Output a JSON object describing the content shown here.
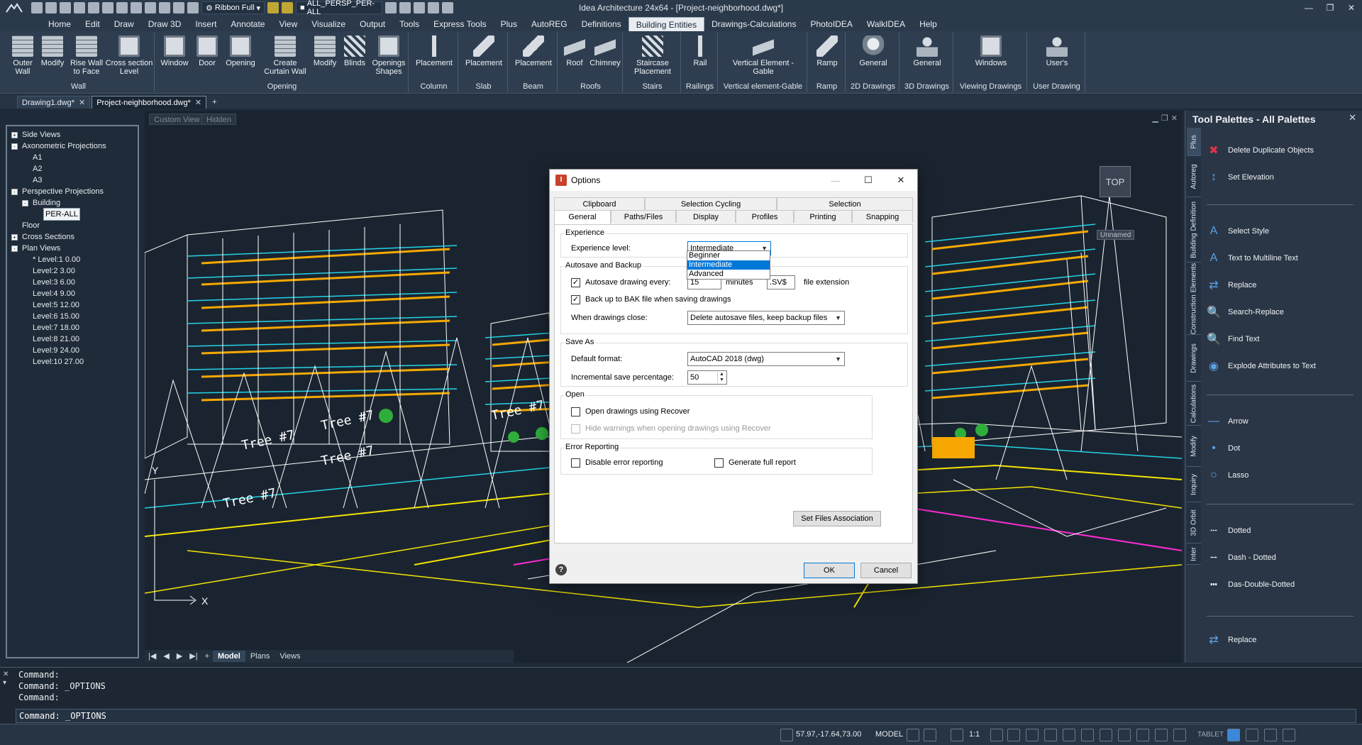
{
  "window": {
    "title": "Idea Architecture 24x64 - [Project-neighborhood.dwg*]",
    "workspace_label": "Ribbon Full",
    "view_selector": "ALL_PERSP_PER-ALL"
  },
  "ribbon_tabs": [
    "Home",
    "Edit",
    "Draw",
    "Draw 3D",
    "Insert",
    "Annotate",
    "View",
    "Visualize",
    "Output",
    "Tools",
    "Express Tools",
    "Plus",
    "AutoREG",
    "Definitions",
    "Building Entities",
    "Drawings-Calculations",
    "PhotoIDEA",
    "WalkIDEA",
    "Help"
  ],
  "ribbon_active_tab": "Building Entities",
  "ribbon_groups": {
    "wall": {
      "label": "Wall",
      "buttons": [
        "Outer Wall",
        "Modify",
        "Rise Wall to Face",
        "Cross section Level"
      ]
    },
    "opening": {
      "label": "Opening",
      "buttons": [
        "Window",
        "Door",
        "Opening",
        "Create Curtain Wall",
        "Modify",
        "Blinds",
        "Openings Shapes"
      ]
    },
    "column": {
      "label": "Column",
      "buttons": [
        "Placement"
      ]
    },
    "slab": {
      "label": "Slab",
      "buttons": [
        "Placement"
      ]
    },
    "beam": {
      "label": "Beam",
      "buttons": [
        "Placement"
      ]
    },
    "roofs": {
      "label": "Roofs",
      "buttons": [
        "Roof",
        "Chimney"
      ]
    },
    "stairs": {
      "label": "Stairs",
      "buttons": [
        "Staircase Placement"
      ]
    },
    "railings": {
      "label": "Railings",
      "buttons": [
        "Rail"
      ]
    },
    "gable": {
      "label": "Vertical element-Gable",
      "buttons": [
        "Vertical Element - Gable"
      ]
    },
    "ramp": {
      "label": "Ramp",
      "buttons": [
        "Ramp"
      ]
    },
    "drawings2d": {
      "label": "2D Drawings",
      "buttons": [
        "General"
      ]
    },
    "drawings3d": {
      "label": "3D Drawings",
      "buttons": [
        "General"
      ]
    },
    "viewing": {
      "label": "Viewing Drawings",
      "buttons": [
        "Windows"
      ]
    },
    "user": {
      "label": "User Drawing",
      "buttons": [
        "User's"
      ]
    }
  },
  "doc_tabs": [
    {
      "label": "Drawing1.dwg*",
      "active": false
    },
    {
      "label": "Project-neighborhood.dwg*",
      "active": true
    }
  ],
  "tree": {
    "items": [
      {
        "label": "Side Views",
        "level": 0,
        "toggle": "+"
      },
      {
        "label": "Axonometric Projections",
        "level": 0,
        "toggle": "-"
      },
      {
        "label": "A1",
        "level": 2
      },
      {
        "label": "A2",
        "level": 2
      },
      {
        "label": "A3",
        "level": 2
      },
      {
        "label": "Perspective Projections",
        "level": 0,
        "toggle": "-"
      },
      {
        "label": "Building",
        "level": 1,
        "toggle": "-"
      },
      {
        "label": "PER-ALL",
        "level": 3,
        "selected": true
      },
      {
        "label": "Floor",
        "level": 1
      },
      {
        "label": "Cross Sections",
        "level": 0,
        "toggle": "+"
      },
      {
        "label": "Plan Views",
        "level": 0,
        "toggle": "-"
      },
      {
        "label": "* Level:1  0.00",
        "level": 2
      },
      {
        "label": "Level:2  3.00",
        "level": 2
      },
      {
        "label": "Level:3  6.00",
        "level": 2
      },
      {
        "label": "Level:4  9.00",
        "level": 2
      },
      {
        "label": "Level:5  12.00",
        "level": 2
      },
      {
        "label": "Level:6  15.00",
        "level": 2
      },
      {
        "label": "Level:7  18.00",
        "level": 2
      },
      {
        "label": "Level:8  21.00",
        "level": 2
      },
      {
        "label": "Level:9  24.00",
        "level": 2
      },
      {
        "label": "Level:10  27.00",
        "level": 2
      }
    ]
  },
  "viewport": {
    "custom_view": "Custom View",
    "hidden": "Hidden",
    "viewcube": "TOP",
    "ucs_name": "Unnamed",
    "tree_labels": [
      "Tree #7",
      "Tree #7",
      "Tree #7",
      "Tree #7",
      "Tree #7"
    ],
    "axis_x": "X",
    "axis_y": "Y"
  },
  "layout_tabs": [
    "Model",
    "Plans",
    "Views"
  ],
  "layout_active": "Model",
  "tool_palette": {
    "title": "Tool Palettes - All Palettes",
    "vertical_tabs": [
      "Plus",
      "Autoreg",
      "Building Definition",
      "Construction Elements",
      "Drawings",
      "Calculations",
      "Modify",
      "Inquiry",
      "3D Orbit",
      "Inter"
    ],
    "items": [
      {
        "label": "Delete Duplicate Objects",
        "icon": "delete-duplicate-icon"
      },
      {
        "label": "Set Elevation",
        "icon": "set-elevation-icon"
      },
      {
        "label": "Select Style",
        "icon": "select-style-icon"
      },
      {
        "label": "Text to Multiline Text",
        "icon": "text-multiline-icon"
      },
      {
        "label": "Replace",
        "icon": "replace-icon"
      },
      {
        "label": "Search-Replace",
        "icon": "search-replace-icon"
      },
      {
        "label": "Find Text",
        "icon": "find-text-icon"
      },
      {
        "label": "Explode Attributes to Text",
        "icon": "explode-attributes-icon"
      },
      {
        "label": "Arrow",
        "icon": "arrow-icon"
      },
      {
        "label": "Dot",
        "icon": "dot-icon"
      },
      {
        "label": "Lasso",
        "icon": "lasso-icon"
      },
      {
        "label": "Dotted",
        "icon": "dotted-line-icon"
      },
      {
        "label": "Dash - Dotted",
        "icon": "dash-dotted-line-icon"
      },
      {
        "label": "Das-Double-Dotted",
        "icon": "dash-double-dotted-icon"
      },
      {
        "label": "Replace",
        "icon": "replace-icon"
      }
    ]
  },
  "command": {
    "history": [
      "Command:",
      "Command:  _OPTIONS",
      "Command:"
    ],
    "input": "Command:  _OPTIONS"
  },
  "status": {
    "coords": "57.97,-17.64,73.00",
    "model": "MODEL",
    "scale": "1:1",
    "tablet": "TABLET"
  },
  "options_dialog": {
    "title": "Options",
    "tabs_row1": [
      "Clipboard",
      "Selection Cycling",
      "Selection"
    ],
    "tabs_row2": [
      "General",
      "Paths/Files",
      "Display",
      "Profiles",
      "Printing",
      "Snapping"
    ],
    "active_tab": "General",
    "experience": {
      "group": "Experience",
      "label": "Experience level:",
      "value": "Intermediate",
      "options": [
        "Beginner",
        "Intermediate",
        "Advanced"
      ]
    },
    "autosave": {
      "group": "Autosave and Backup",
      "autosave_label": "Autosave drawing every:",
      "autosave_checked": true,
      "autosave_minutes": "15",
      "minutes_label": "minutes",
      "extension": ".SV$",
      "extension_label": "file extension",
      "bak_label": "Back up to BAK file when saving drawings",
      "bak_checked": true,
      "close_label": "When drawings close:",
      "close_value": "Delete autosave files, keep backup files"
    },
    "save_as": {
      "group": "Save As",
      "format_label": "Default format:",
      "format_value": "AutoCAD 2018 (dwg)",
      "incremental_label": "Incremental save percentage:",
      "incremental_value": "50"
    },
    "open": {
      "group": "Open",
      "recover_label": "Open drawings using Recover",
      "hide_warnings_label": "Hide warnings when opening drawings using Recover"
    },
    "error": {
      "group": "Error Reporting",
      "disable_label": "Disable error reporting",
      "full_report_label": "Generate full report"
    },
    "files_assoc_button": "Set Files Association",
    "ok_button": "OK",
    "cancel_button": "Cancel",
    "help_symbol": "?"
  }
}
